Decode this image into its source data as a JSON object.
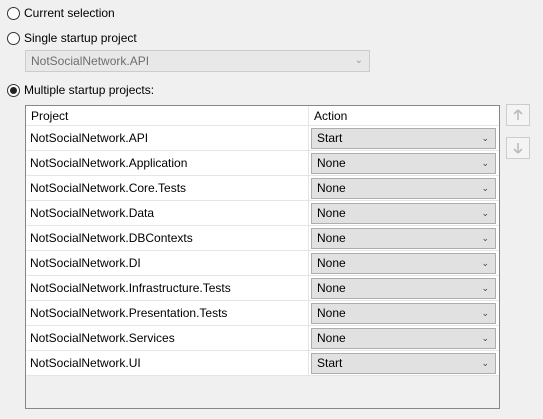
{
  "options": {
    "current_selection": "Current selection",
    "single_startup": "Single startup project",
    "multiple_startup": "Multiple startup projects:"
  },
  "single_project_value": "NotSocialNetwork.API",
  "grid": {
    "columns": [
      "Project",
      "Action"
    ],
    "rows": [
      {
        "project": "NotSocialNetwork.API",
        "action": "Start"
      },
      {
        "project": "NotSocialNetwork.Application",
        "action": "None"
      },
      {
        "project": "NotSocialNetwork.Core.Tests",
        "action": "None"
      },
      {
        "project": "NotSocialNetwork.Data",
        "action": "None"
      },
      {
        "project": "NotSocialNetwork.DBContexts",
        "action": "None"
      },
      {
        "project": "NotSocialNetwork.DI",
        "action": "None"
      },
      {
        "project": "NotSocialNetwork.Infrastructure.Tests",
        "action": "None"
      },
      {
        "project": "NotSocialNetwork.Presentation.Tests",
        "action": "None"
      },
      {
        "project": "NotSocialNetwork.Services",
        "action": "None"
      },
      {
        "project": "NotSocialNetwork.UI",
        "action": "Start"
      }
    ]
  },
  "icons": {
    "move_up": "arrow-up-icon",
    "move_down": "arrow-down-icon",
    "dropdown": "chevron-down-icon"
  }
}
